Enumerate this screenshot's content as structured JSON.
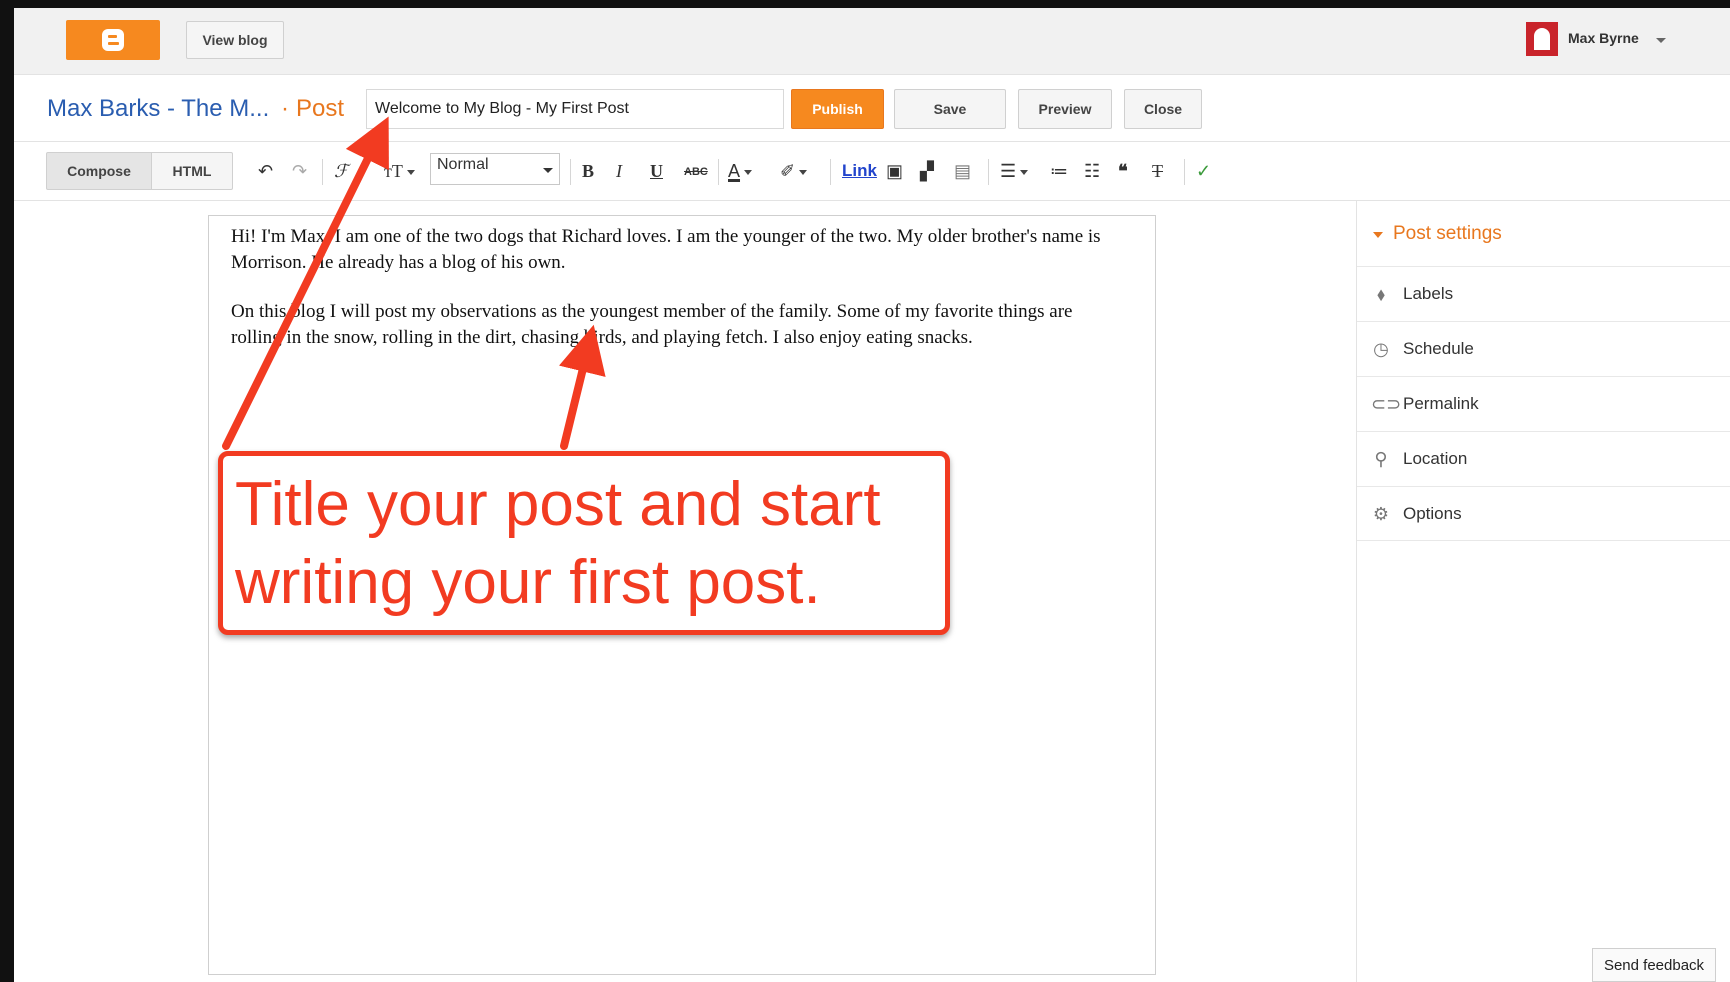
{
  "topbar": {
    "view_blog_label": "View blog",
    "username": "Max Byrne"
  },
  "titlerow": {
    "blog_name": "Max Barks - The M...",
    "separator": "·",
    "post_word": "Post",
    "title_value": "Welcome to My Blog - My First Post",
    "publish_label": "Publish",
    "save_label": "Save",
    "preview_label": "Preview",
    "close_label": "Close"
  },
  "toolbar": {
    "compose_label": "Compose",
    "html_label": "HTML",
    "format_value": "Normal",
    "link_label": "Link"
  },
  "editor": {
    "paragraphs": [
      "Hi! I'm Max. I am one of the two dogs that Richard loves. I am the younger of the two. My older brother's name is Morrison. He already has a blog of his own.",
      "On this blog I will post my observations as the youngest member of the family. Some of my favorite things are rolling in the snow, rolling in the dirt, chasing birds, and playing fetch. I also enjoy eating snacks."
    ]
  },
  "sidebar": {
    "heading": "Post settings",
    "items": [
      {
        "label": "Labels",
        "icon": "tag-icon"
      },
      {
        "label": "Schedule",
        "icon": "clock-icon"
      },
      {
        "label": "Permalink",
        "icon": "link-icon"
      },
      {
        "label": "Location",
        "icon": "map-pin-icon"
      },
      {
        "label": "Options",
        "icon": "gear-icon"
      }
    ]
  },
  "feedback_label": "Send feedback",
  "callout": {
    "text": "Title your post and start writing your first post.",
    "color": "#f23b21"
  },
  "colors": {
    "brand_orange": "#f6891f",
    "blog_link_blue": "#2a5db0"
  }
}
